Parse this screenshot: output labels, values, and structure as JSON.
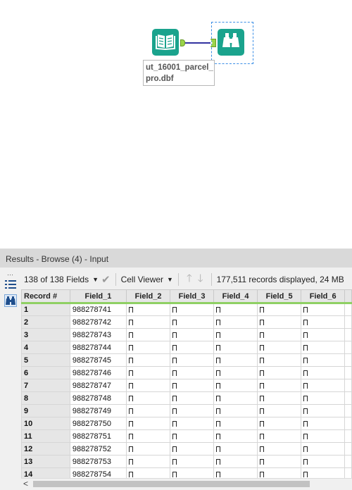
{
  "canvas": {
    "input_tool_label": "ut_16001_parcel_\npro.dbf",
    "colors": {
      "tool": "#1aa38d",
      "connector": "#3333a0",
      "anchor": "#9bd44a"
    }
  },
  "results": {
    "title": "Results - Browse (4) - Input",
    "toolbar": {
      "fields_label": "138 of 138 Fields",
      "viewer_label": "Cell Viewer",
      "status": "177,511 records displayed, 24 MB"
    },
    "columns": [
      "Record #",
      "Field_1",
      "Field_2",
      "Field_3",
      "Field_4",
      "Field_5",
      "Field_6"
    ],
    "rows": [
      {
        "record": "1",
        "field_1": "988278741"
      },
      {
        "record": "2",
        "field_1": "988278742"
      },
      {
        "record": "3",
        "field_1": "988278743"
      },
      {
        "record": "4",
        "field_1": "988278744"
      },
      {
        "record": "5",
        "field_1": "988278745"
      },
      {
        "record": "6",
        "field_1": "988278746"
      },
      {
        "record": "7",
        "field_1": "988278747"
      },
      {
        "record": "8",
        "field_1": "988278748"
      },
      {
        "record": "9",
        "field_1": "988278749"
      },
      {
        "record": "10",
        "field_1": "988278750"
      },
      {
        "record": "11",
        "field_1": "988278751"
      },
      {
        "record": "12",
        "field_1": "988278752"
      },
      {
        "record": "13",
        "field_1": "988278753"
      },
      {
        "record": "14",
        "field_1": "988278754"
      }
    ]
  }
}
